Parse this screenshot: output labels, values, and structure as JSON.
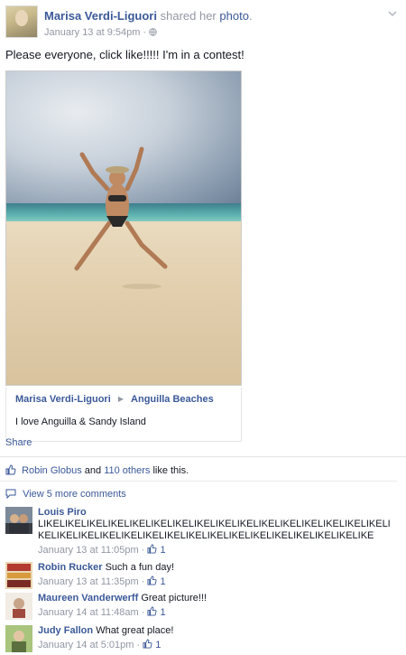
{
  "post": {
    "author": "Marisa Verdi-Liguori",
    "action_prefix": "shared her",
    "action_link": "photo",
    "action_suffix": ".",
    "timestamp": "January 13 at 9:54pm",
    "separator": "·",
    "audience_icon": "public-globe-icon",
    "caption": "Please everyone, click like!!!!! I'm in a contest!"
  },
  "album": {
    "owner": "Marisa Verdi-Liguori",
    "album_name": "Anguilla Beaches",
    "description": "I love Anguilla & Sandy Island"
  },
  "actions": {
    "share": "Share"
  },
  "likes": {
    "name": "Robin Globus",
    "joiner": "and",
    "others": "110 others",
    "suffix": "like this."
  },
  "comments_link": "View 5 more comments",
  "comments": [
    {
      "author": "Louis Piro",
      "text": "LIKELIKELIKELIKELIKELIKELIKELIKELIKELIKELIKELIKELIKELIKELIKELIKELIKELIKELIKELIKELIKELIKELIKELIKELIKELIKELIKELIKELIKELIKELIKELIKE",
      "time": "January 13 at 11:05pm",
      "likes": "1"
    },
    {
      "author": "Robin Rucker",
      "text": "Such a fun day!",
      "time": "January 13 at 11:35pm",
      "likes": "1"
    },
    {
      "author": "Maureen Vanderwerff",
      "text": "Great picture!!!",
      "time": "January 14 at 11:48am",
      "likes": "1"
    },
    {
      "author": "Judy Fallon",
      "text": "What great place!",
      "time": "January 14 at 5:01pm",
      "likes": "1"
    }
  ],
  "colors": {
    "link": "#3b5998",
    "meta": "#9197a3",
    "text": "#141823"
  }
}
